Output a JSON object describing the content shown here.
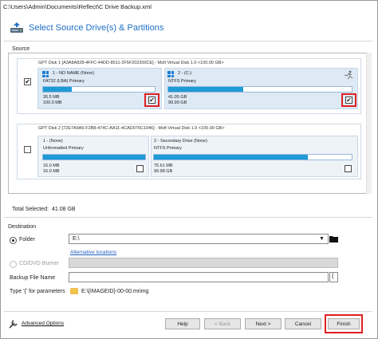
{
  "window": {
    "title": "C:\\Users\\Admin\\Documents\\Reflect\\C Drive Backup.xml"
  },
  "header": {
    "title": "Select Source Drive(s) & Partitions",
    "icon": "drive-backup-icon"
  },
  "source": {
    "label": "Source",
    "disks": [
      {
        "header": "GPT Disk 1 [A3A8A828-4FFC-44DD-8511-2F5F202200CE] - Msft    Virtual Disk    1.0  <100.00 GB>",
        "checked": true,
        "partitions": [
          {
            "name": "1 - NO NAME (None)",
            "fs": "FAT32 (LBA) Primary",
            "used": "26.5 MB",
            "total": "100.0 MB",
            "fill": 0.26,
            "checked": true,
            "icon": "windows-icon"
          },
          {
            "name": "2 - (C:)",
            "fs": "NTFS Primary",
            "used": "41.05 GB",
            "total": "99.90 GB",
            "fill": 0.41,
            "checked": true,
            "icon": "windows-icon"
          }
        ]
      },
      {
        "header": "GPT Disk 2 [72E7A9A6-F2B8-474C-AA11-4CAD075C1046] - Msft    Virtual Disk    1.0  <100.00 GB>",
        "checked": false,
        "partitions": [
          {
            "name": "1 - (None)",
            "fs": "Unformatted Primary",
            "used": "16.0 MB",
            "total": "16.0 MB",
            "fill": 1.0,
            "checked": false
          },
          {
            "name": "2 - Secondary Drive (None)",
            "fs": "NTFS Primary",
            "used": "75.61 MB",
            "total": "99.98 GB",
            "fill": 0.78,
            "checked": false
          }
        ]
      }
    ]
  },
  "total": {
    "label": "Total Selected:",
    "value": "41.08 GB"
  },
  "destination": {
    "label": "Destination",
    "folder_label": "Folder",
    "folder_value": "E:\\",
    "alt_link": "Alternative locations",
    "cd_label": "CD/DVD Burner",
    "backup_name_label": "Backup File Name",
    "backup_name_value": "",
    "params_label": "Type '{' for parameters",
    "params_value": "E:\\{IMAGEID}-00-00.mrimg"
  },
  "footer": {
    "advanced": "Advanced Options",
    "help": "Help",
    "back": "< Back",
    "next": "Next >",
    "cancel": "Cancel",
    "finish": "Finish"
  },
  "colors": {
    "accent": "#1f6fc6",
    "bar": "#1e9ad6",
    "highlight": "#e02020"
  }
}
